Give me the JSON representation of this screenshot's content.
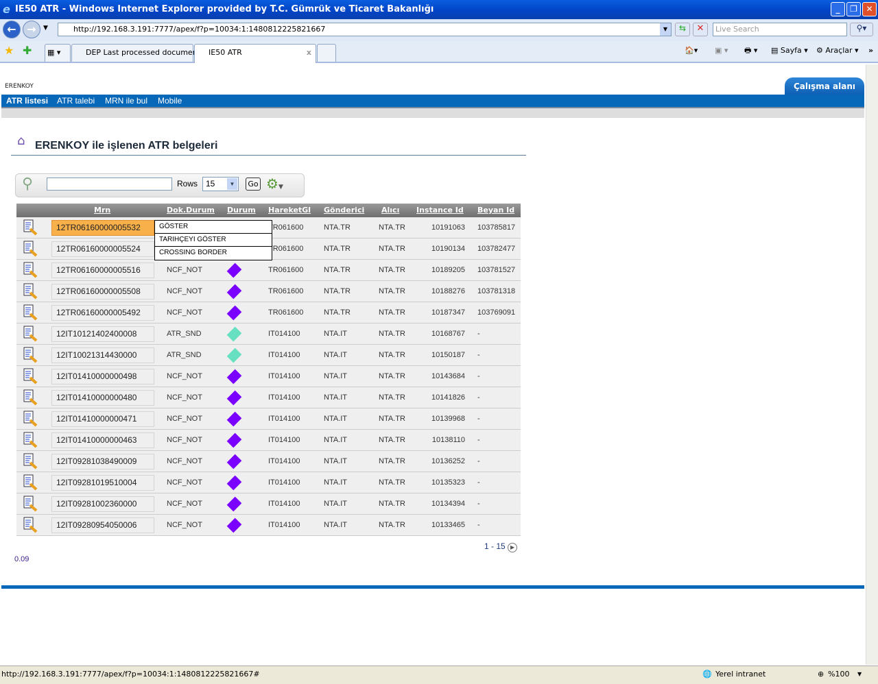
{
  "window": {
    "title": "IE50 ATR - Windows Internet Explorer provided by T.C. Gümrük ve Ticaret Bakanlığı"
  },
  "browser": {
    "url": "http://192.168.3.191:7777/apex/f?p=10034:1:1480812225821667",
    "search_placeholder": "Live Search",
    "tabs": [
      {
        "label": "DEP Last processed documents",
        "active": false
      },
      {
        "label": "IE50 ATR",
        "active": true
      }
    ],
    "toolbar": {
      "page": "Sayfa",
      "tools": "Araçlar"
    },
    "status_url": "http://192.168.3.191:7777/apex/f?p=10034:1:1480812225821667#",
    "zone": "Yerel intranet",
    "zoom": "%100"
  },
  "app": {
    "brand": "ERENKOY",
    "workspace_tab": "Çalışma alanı",
    "menu": [
      "ATR listesi",
      "ATR talebi",
      "MRN ile bul",
      "Mobile"
    ],
    "page_title": "ERENKOY ile işlenen ATR belgeleri",
    "search": {
      "value": "",
      "rows_label": "Rows",
      "rows_value": "15",
      "go_label": "Go"
    },
    "columns": [
      "Mrn",
      "Dok.Durum",
      "Durum",
      "HareketGl",
      "Gönderici",
      "Alıcı",
      "Instance Id",
      "Beyan Id"
    ],
    "status_colors": {
      "NCF_NOT": "#7a00ff",
      "ATR_SND": "#66e0c0"
    },
    "rows": [
      {
        "mrn": "12TR06160000005532",
        "dok": "",
        "durum": "",
        "hareket": "TR061600",
        "gonderici": "NTA.TR",
        "alici": "NTA.TR",
        "instance": "10191063",
        "beyan": "103785817",
        "selected": true
      },
      {
        "mrn": "12TR06160000005524",
        "dok": "",
        "durum": "",
        "hareket": "TR061600",
        "gonderici": "NTA.TR",
        "alici": "NTA.TR",
        "instance": "10190134",
        "beyan": "103782477"
      },
      {
        "mrn": "12TR06160000005516",
        "dok": "NCF_NOT",
        "durum": "NCF_NOT",
        "hareket": "TR061600",
        "gonderici": "NTA.TR",
        "alici": "NTA.TR",
        "instance": "10189205",
        "beyan": "103781527"
      },
      {
        "mrn": "12TR06160000005508",
        "dok": "NCF_NOT",
        "durum": "NCF_NOT",
        "hareket": "TR061600",
        "gonderici": "NTA.TR",
        "alici": "NTA.TR",
        "instance": "10188276",
        "beyan": "103781318"
      },
      {
        "mrn": "12TR06160000005492",
        "dok": "NCF_NOT",
        "durum": "NCF_NOT",
        "hareket": "TR061600",
        "gonderici": "NTA.TR",
        "alici": "NTA.TR",
        "instance": "10187347",
        "beyan": "103769091"
      },
      {
        "mrn": "12IT10121402400008",
        "dok": "ATR_SND",
        "durum": "ATR_SND",
        "hareket": "IT014100",
        "gonderici": "NTA.IT",
        "alici": "NTA.TR",
        "instance": "10168767",
        "beyan": "-"
      },
      {
        "mrn": "12IT10021314430000",
        "dok": "ATR_SND",
        "durum": "ATR_SND",
        "hareket": "IT014100",
        "gonderici": "NTA.IT",
        "alici": "NTA.TR",
        "instance": "10150187",
        "beyan": "-"
      },
      {
        "mrn": "12IT01410000000498",
        "dok": "NCF_NOT",
        "durum": "NCF_NOT",
        "hareket": "IT014100",
        "gonderici": "NTA.IT",
        "alici": "NTA.TR",
        "instance": "10143684",
        "beyan": "-"
      },
      {
        "mrn": "12IT01410000000480",
        "dok": "NCF_NOT",
        "durum": "NCF_NOT",
        "hareket": "IT014100",
        "gonderici": "NTA.IT",
        "alici": "NTA.TR",
        "instance": "10141826",
        "beyan": "-"
      },
      {
        "mrn": "12IT01410000000471",
        "dok": "NCF_NOT",
        "durum": "NCF_NOT",
        "hareket": "IT014100",
        "gonderici": "NTA.IT",
        "alici": "NTA.TR",
        "instance": "10139968",
        "beyan": "-"
      },
      {
        "mrn": "12IT01410000000463",
        "dok": "NCF_NOT",
        "durum": "NCF_NOT",
        "hareket": "IT014100",
        "gonderici": "NTA.IT",
        "alici": "NTA.TR",
        "instance": "10138110",
        "beyan": "-"
      },
      {
        "mrn": "12IT09281038490009",
        "dok": "NCF_NOT",
        "durum": "NCF_NOT",
        "hareket": "IT014100",
        "gonderici": "NTA.IT",
        "alici": "NTA.TR",
        "instance": "10136252",
        "beyan": "-"
      },
      {
        "mrn": "12IT09281019510004",
        "dok": "NCF_NOT",
        "durum": "NCF_NOT",
        "hareket": "IT014100",
        "gonderici": "NTA.IT",
        "alici": "NTA.TR",
        "instance": "10135323",
        "beyan": "-"
      },
      {
        "mrn": "12IT09281002360000",
        "dok": "NCF_NOT",
        "durum": "NCF_NOT",
        "hareket": "IT014100",
        "gonderici": "NTA.IT",
        "alici": "NTA.TR",
        "instance": "10134394",
        "beyan": "-"
      },
      {
        "mrn": "12IT09280954050006",
        "dok": "NCF_NOT",
        "durum": "NCF_NOT",
        "hareket": "IT014100",
        "gonderici": "NTA.IT",
        "alici": "NTA.TR",
        "instance": "10133465",
        "beyan": "-"
      }
    ],
    "context_menu": [
      "GÖSTER",
      "TARIHÇEYI GÖSTER",
      "CROSSING BORDER"
    ],
    "pager": "1 - 15",
    "timing": "0.09"
  }
}
